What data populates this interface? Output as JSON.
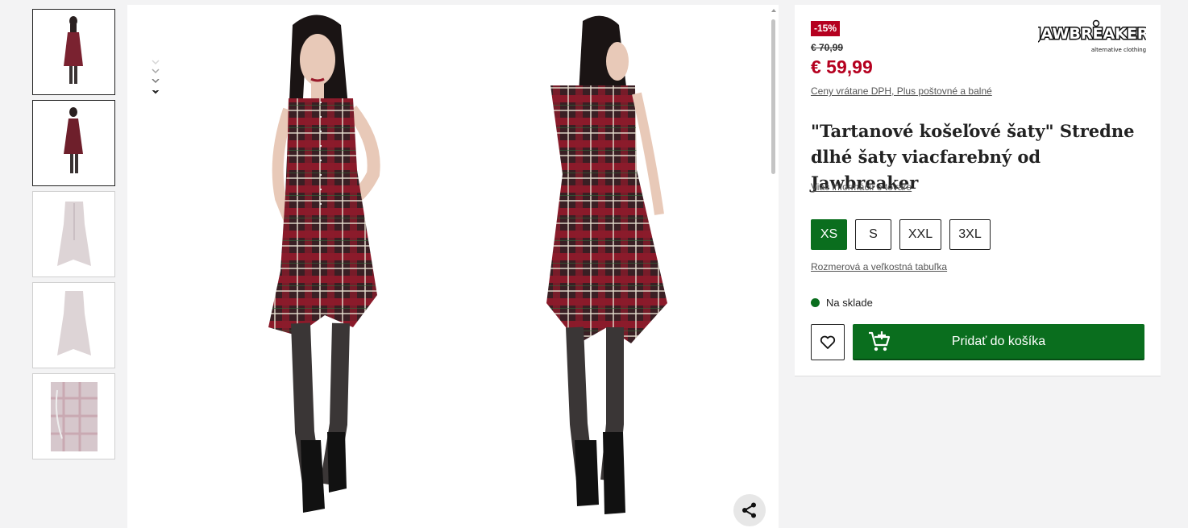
{
  "thumbnails": [
    {
      "label": "model-front"
    },
    {
      "label": "model-back"
    },
    {
      "label": "dress-front"
    },
    {
      "label": "dress-back"
    },
    {
      "label": "fabric-detail"
    }
  ],
  "product": {
    "discount_badge": "-15%",
    "old_price": "€ 70,99",
    "price": "€ 59,99",
    "tax_note": "Ceny vrátane DPH, Plus poštovné a balné",
    "title": "\"Tartanové košeľové šaty\" Stredne dlhé šaty viacfarebný od Jawbreaker",
    "info_link": "Viac informácií o tovare",
    "sizes": [
      {
        "label": "XS",
        "selected": true
      },
      {
        "label": "S",
        "selected": false
      },
      {
        "label": "XXL",
        "selected": false
      },
      {
        "label": "3XL",
        "selected": false
      }
    ],
    "size_chart_link": "Rozmerová a veľkostná tabuľka",
    "stock_status": "Na sklade",
    "add_to_cart": "Pridať do košíka"
  },
  "brand": {
    "logo_text": "JAWBREAKER",
    "logo_tagline": "alternative clothing"
  },
  "colors": {
    "accent_green": "#0a6e1e",
    "sale_red": "#b5001f",
    "tartan_red": "#8b1a2a",
    "tartan_dark": "#2a1f1f"
  },
  "icons": {
    "share": "share-icon",
    "wishlist": "heart-icon",
    "cart": "cart-add-icon",
    "gallery_nav": "chevron-down-icon"
  }
}
